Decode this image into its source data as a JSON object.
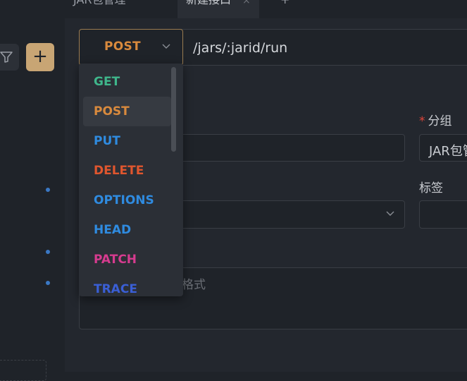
{
  "tabs": [
    {
      "label": "JAR包管理"
    },
    {
      "label": "新建接口",
      "close": "×"
    },
    {
      "label": "+"
    }
  ],
  "sidebar": {
    "add_label": "+"
  },
  "request": {
    "method": "POST",
    "url": "/jars/:jarid/run"
  },
  "methods": [
    {
      "label": "GET",
      "color": "#3fb68b"
    },
    {
      "label": "POST",
      "color": "#d98a3d"
    },
    {
      "label": "PUT",
      "color": "#2f8be0"
    },
    {
      "label": "DELETE",
      "color": "#e0562e"
    },
    {
      "label": "OPTIONS",
      "color": "#2f8be0"
    },
    {
      "label": "HEAD",
      "color": "#2f8be0"
    },
    {
      "label": "PATCH",
      "color": "#d63b8f"
    },
    {
      "label": "TRACE",
      "color": "#3a5fd6"
    }
  ],
  "form": {
    "group_label": "分组",
    "group_required": "*",
    "group_value": "JAR包管理",
    "tags_label": "标签",
    "desc_placeholder": "格式"
  }
}
